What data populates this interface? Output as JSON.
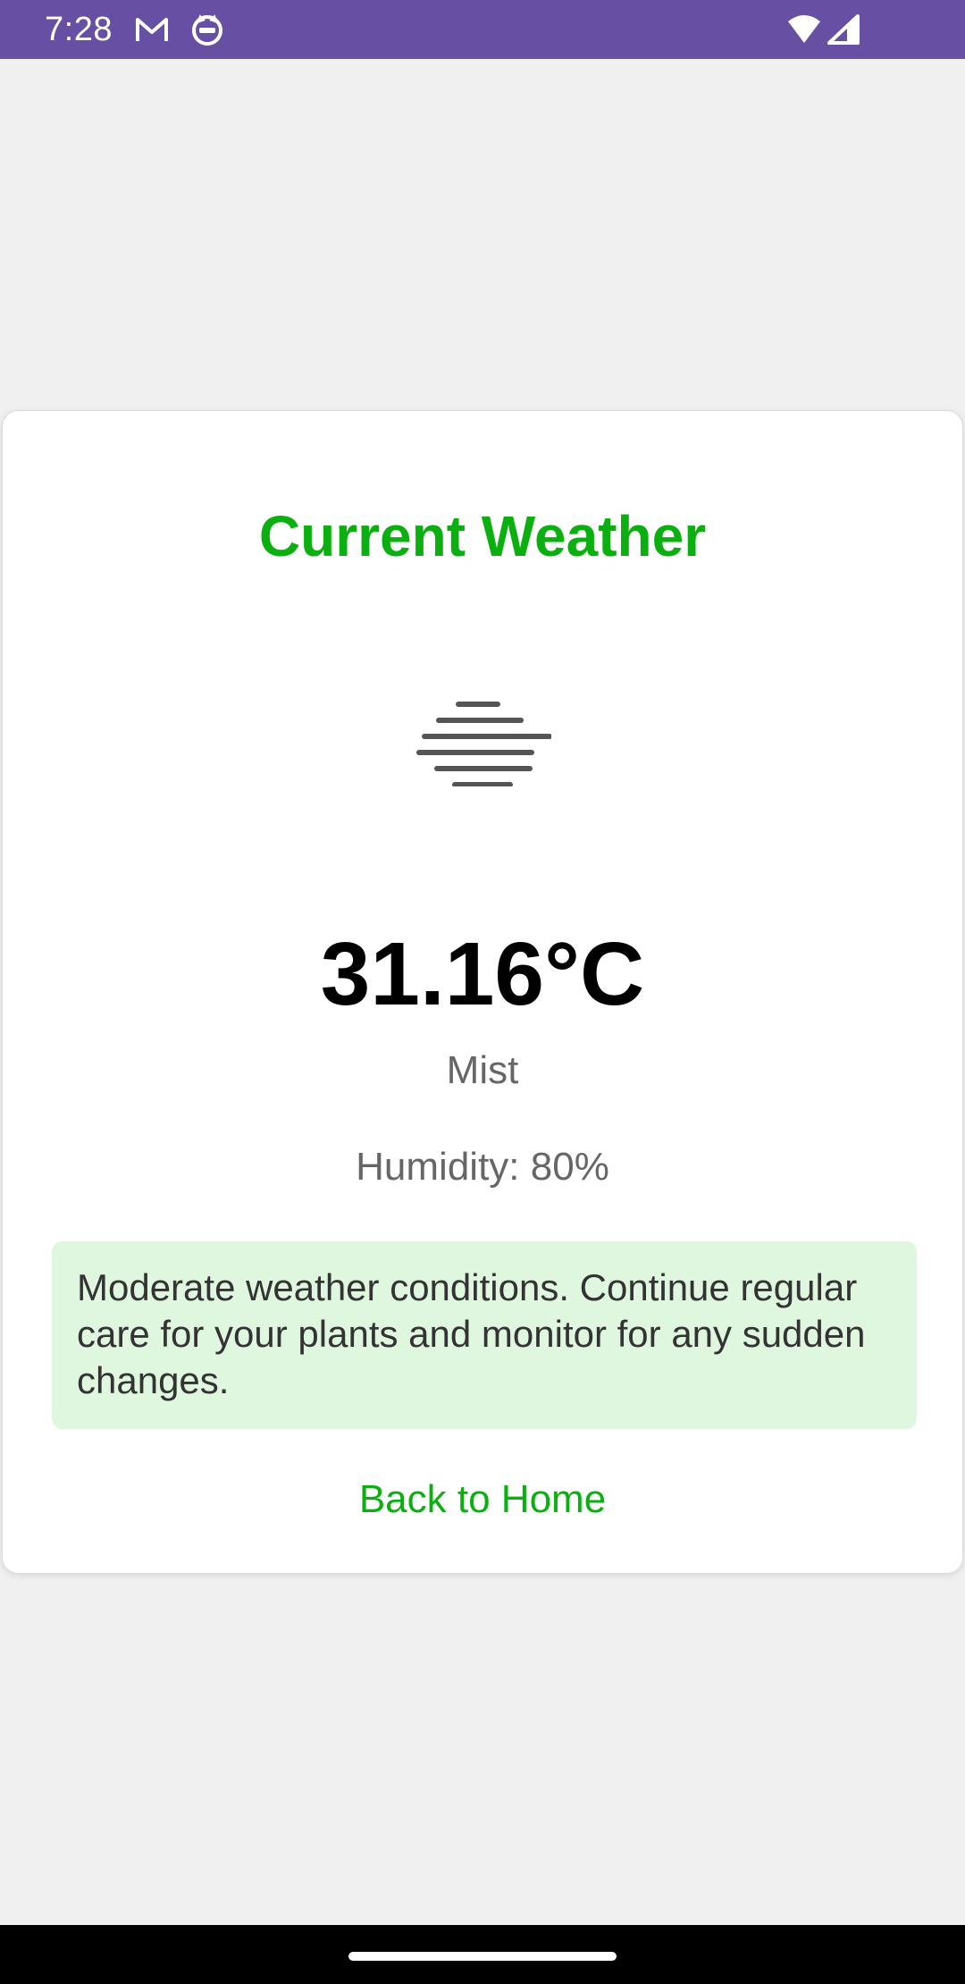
{
  "status_bar": {
    "time": "7:28",
    "icons": [
      "gmail-icon",
      "cat-app-icon",
      "wifi-icon",
      "signal-icon"
    ]
  },
  "card": {
    "title": "Current Weather",
    "weather_icon": "mist-icon",
    "temperature": "31.16°C",
    "condition": "Mist",
    "humidity": "Humidity: 80%",
    "advice": "Moderate weather conditions. Continue regular care for your plants and monitor for any sudden changes.",
    "back_link": "Back to Home"
  },
  "colors": {
    "status_bar": "#6750a4",
    "accent": "#0bb010",
    "advice_bg": "#dff6df",
    "page_bg": "#f0f0f0"
  }
}
